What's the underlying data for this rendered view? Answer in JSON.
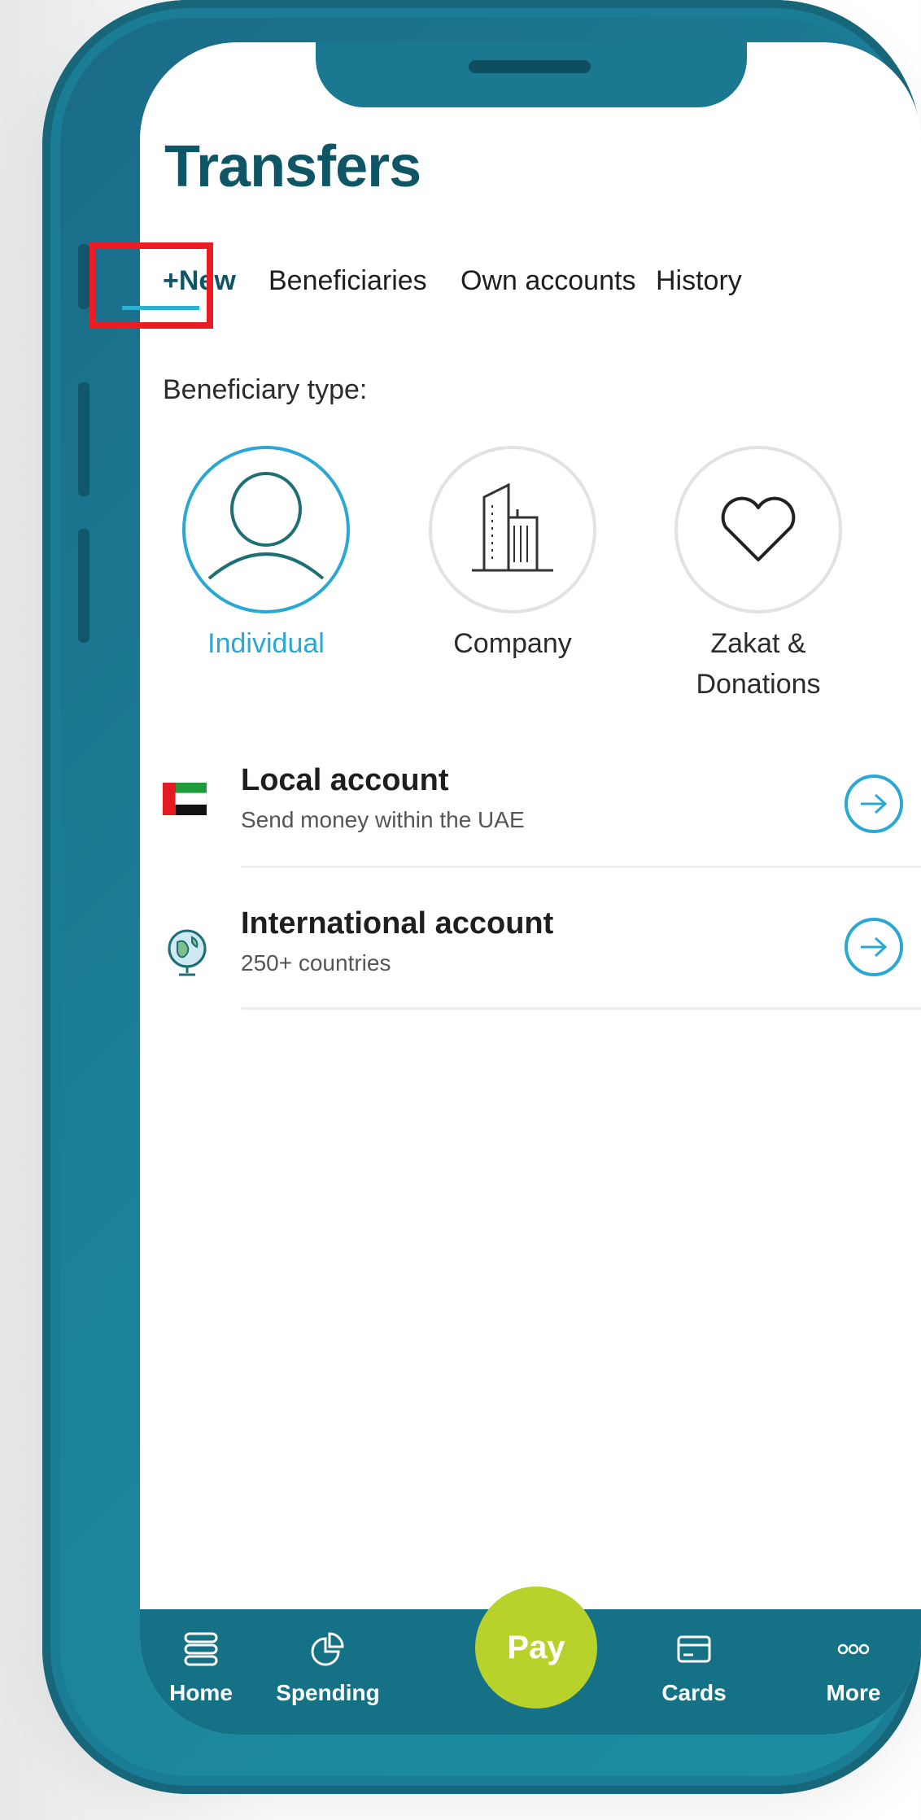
{
  "header": {
    "title": "Transfers"
  },
  "tabs": [
    {
      "label": "+New",
      "active": true
    },
    {
      "label": "Beneficiaries",
      "active": false
    },
    {
      "label": "Own accounts",
      "active": false
    },
    {
      "label": "History",
      "active": false
    }
  ],
  "beneficiary": {
    "section_label": "Beneficiary type:",
    "types": [
      {
        "label": "Individual",
        "icon": "person-icon",
        "selected": true
      },
      {
        "label": "Company",
        "icon": "building-icon",
        "selected": false
      },
      {
        "label": "Zakat &\nDonations",
        "icon": "heart-icon",
        "selected": false
      }
    ]
  },
  "accounts": [
    {
      "title": "Local account",
      "subtitle": "Send money within the UAE",
      "icon": "uae-flag-icon"
    },
    {
      "title": "International account",
      "subtitle": "250+ countries",
      "icon": "globe-icon"
    }
  ],
  "bottom_nav": {
    "home": "Home",
    "spending": "Spending",
    "pay": "Pay",
    "cards": "Cards",
    "more": "More"
  },
  "colors": {
    "brand_teal": "#0e5566",
    "accent_blue": "#2aa8d3",
    "nav_bg": "#157186",
    "pay_green": "#b9d22b",
    "highlight_red": "#ec1c24"
  }
}
